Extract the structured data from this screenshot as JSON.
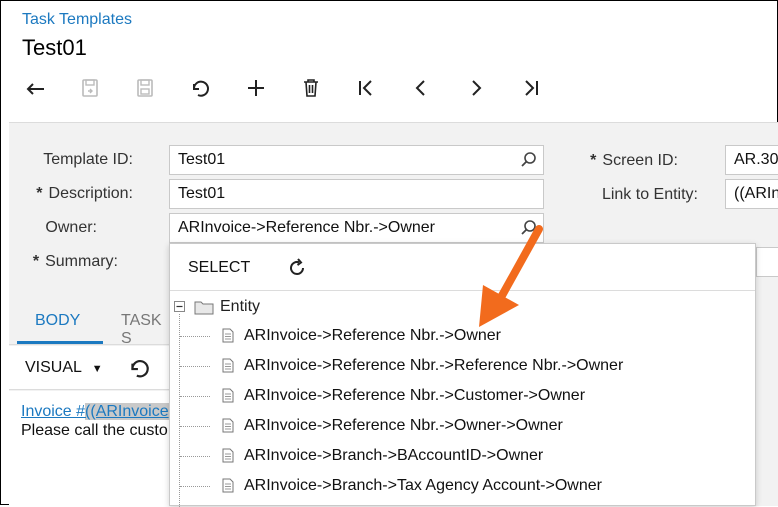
{
  "breadcrumb": "Task Templates",
  "title": "Test01",
  "form": {
    "template_id_label": "Template ID:",
    "template_id_value": "Test01",
    "description_label": "Description:",
    "description_value": "Test01",
    "owner_label": "Owner:",
    "owner_value": "ARInvoice->Reference Nbr.->Owner",
    "summary_label": "Summary:",
    "screen_id_label": "Screen ID:",
    "screen_id_value": "AR.30",
    "link_label": "Link to Entity:",
    "link_value": "((ARIn",
    "required_mark": "*"
  },
  "tabs": {
    "body": "BODY",
    "task": "TASK S"
  },
  "editor": {
    "visual_label": "VISUAL",
    "link_prefix": "Invoice #",
    "link_highlight": "((ARInvoice",
    "text_line": "Please call the custo"
  },
  "dropdown": {
    "select_label": "SELECT",
    "root_label": "Entity",
    "items": [
      "ARInvoice->Reference Nbr.->Owner",
      "ARInvoice->Reference Nbr.->Reference Nbr.->Owner",
      "ARInvoice->Reference Nbr.->Customer->Owner",
      "ARInvoice->Reference Nbr.->Owner->Owner",
      "ARInvoice->Branch->BAccountID->Owner",
      "ARInvoice->Branch->Tax Agency Account->Owner"
    ]
  },
  "colors": {
    "accent": "#1c79c0",
    "arrow": "#f26b1d",
    "panel": "#f2f2f2"
  },
  "icons": {
    "toolbar": [
      "back-arrow-icon",
      "save-close-icon",
      "save-icon",
      "undo-icon",
      "add-icon",
      "delete-icon",
      "first-icon",
      "previous-icon",
      "next-icon",
      "last-icon"
    ]
  }
}
